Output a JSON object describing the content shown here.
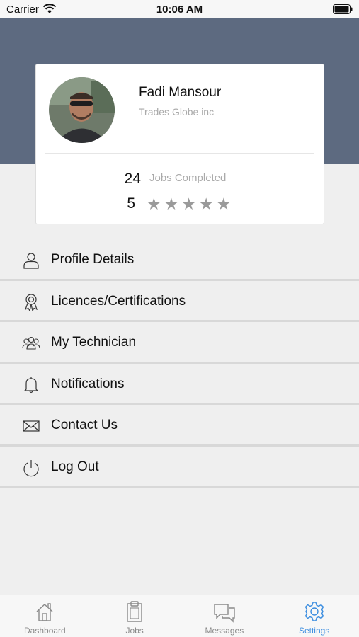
{
  "status_bar": {
    "carrier": "Carrier",
    "time": "10:06 AM"
  },
  "profile": {
    "name": "Fadi Mansour",
    "company": "Trades Globe inc",
    "jobs_completed": "24",
    "jobs_label": "Jobs Completed",
    "rating": "5",
    "stars": "★★★★★"
  },
  "menu": {
    "items": [
      {
        "label": "Profile Details",
        "icon": "person-icon"
      },
      {
        "label": "Licences/Certifications",
        "icon": "award-icon"
      },
      {
        "label": "My Technician",
        "icon": "group-icon"
      },
      {
        "label": "Notifications",
        "icon": "bell-icon"
      },
      {
        "label": "Contact Us",
        "icon": "envelope-icon"
      },
      {
        "label": "Log Out",
        "icon": "power-icon"
      }
    ]
  },
  "tabs": [
    {
      "label": "Dashboard",
      "icon": "home-icon",
      "active": false
    },
    {
      "label": "Jobs",
      "icon": "clipboard-icon",
      "active": false
    },
    {
      "label": "Messages",
      "icon": "chat-icon",
      "active": false
    },
    {
      "label": "Settings",
      "icon": "gear-icon",
      "active": true
    }
  ],
  "colors": {
    "header": "#5d6a80",
    "accent": "#3d8ee0",
    "background": "#efefef"
  }
}
